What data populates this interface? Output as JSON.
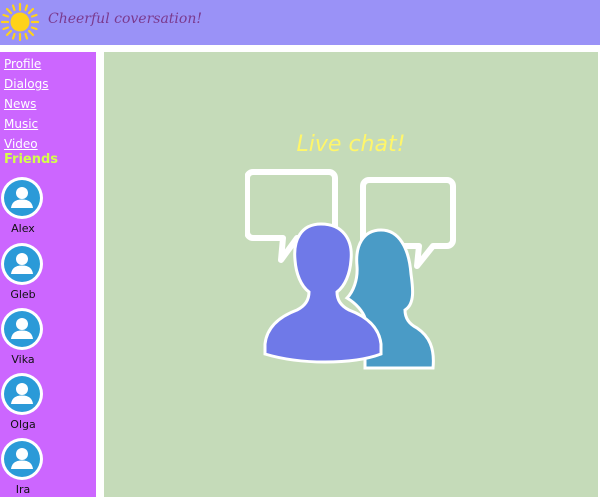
{
  "header": {
    "title": "Cheerful coversation!",
    "logo_icon": "sun-icon"
  },
  "sidebar": {
    "nav": [
      {
        "label": "Profile"
      },
      {
        "label": "Dialogs"
      },
      {
        "label": "News"
      },
      {
        "label": "Music"
      },
      {
        "label": "Video"
      }
    ],
    "friends_heading": "Friends",
    "friends": [
      {
        "name": "Alex",
        "icon": "user-avatar-icon"
      },
      {
        "name": "Gleb",
        "icon": "user-avatar-icon"
      },
      {
        "name": "Vika",
        "icon": "user-avatar-icon"
      },
      {
        "name": "Olga",
        "icon": "user-avatar-icon"
      },
      {
        "name": "Ira",
        "icon": "user-avatar-icon"
      }
    ]
  },
  "main": {
    "headline": "Live chat!",
    "illustration_icon": "live-chat-people-icon"
  },
  "colors": {
    "header_bg": "#9a92f7",
    "sidebar_bg": "#cc66ff",
    "main_bg": "#c5dbb9",
    "friends_heading": "#d4ff4a",
    "headline": "#fff66a",
    "avatar_blue": "#2b9ad8",
    "person_front": "#6f79e8",
    "person_back": "#4a9bc6"
  }
}
